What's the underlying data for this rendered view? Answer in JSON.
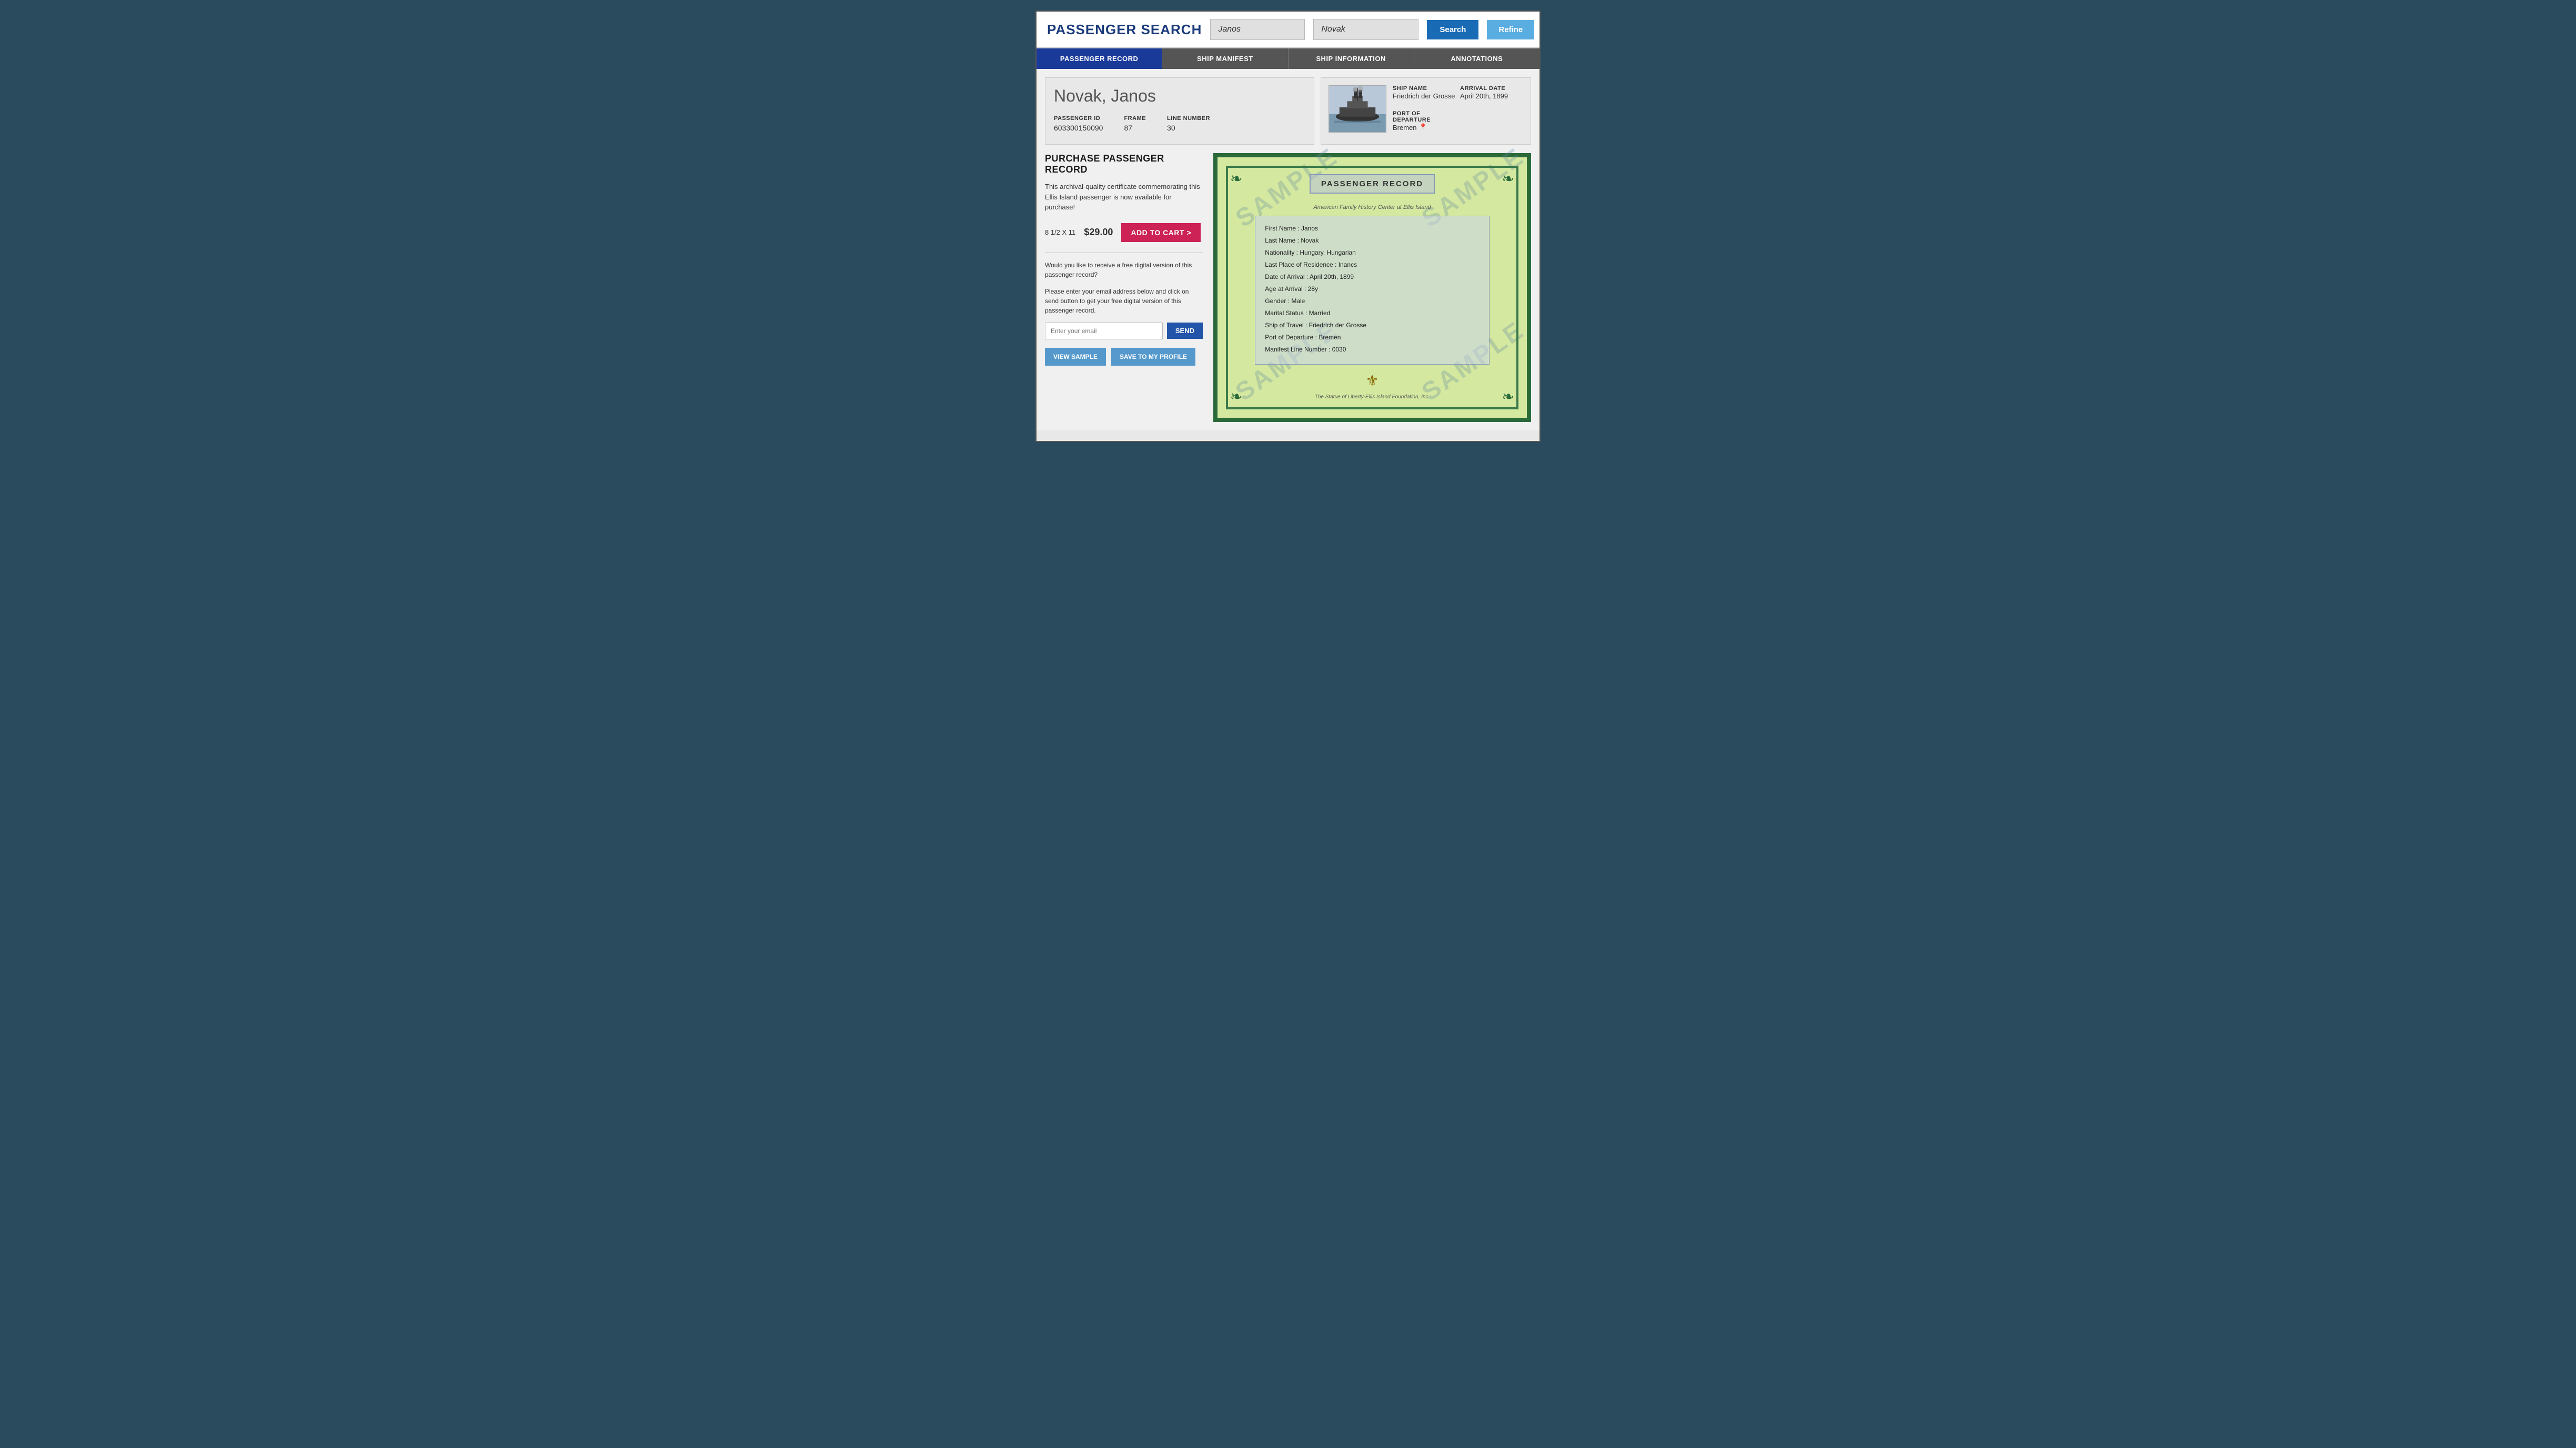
{
  "header": {
    "title": "PASSENGER SEARCH",
    "first_name_value": "Janos",
    "last_name_value": "Novak",
    "first_name_placeholder": "Janos",
    "last_name_placeholder": "Novak",
    "search_label": "Search",
    "refine_label": "Refine"
  },
  "tabs": [
    {
      "id": "passenger-record",
      "label": "PASSENGER RECORD",
      "active": true
    },
    {
      "id": "ship-manifest",
      "label": "SHIP MANIFEST",
      "active": false
    },
    {
      "id": "ship-information",
      "label": "SHIP INFORMATION",
      "active": false
    },
    {
      "id": "annotations",
      "label": "ANNOTATIONS",
      "active": false
    }
  ],
  "passenger": {
    "name": "Novak, Janos",
    "id_label": "PASSENGER ID",
    "id_value": "603300150090",
    "frame_label": "FRAME",
    "frame_value": "87",
    "line_label": "LINE NUMBER",
    "line_value": "30"
  },
  "ship": {
    "name_label": "SHIP NAME",
    "name_value": "Friedrich der Grosse",
    "arrival_label": "ARRIVAL DATE",
    "arrival_value": "April 20th, 1899",
    "departure_label": "PORT OF DEPARTURE",
    "departure_value": "Bremen"
  },
  "purchase": {
    "title": "PURCHASE PASSENGER RECORD",
    "description": "This archival-quality certificate commemorating this Ellis Island passenger is now available for purchase!",
    "size": "8 1/2 X 11",
    "price": "$29.00",
    "add_to_cart": "ADD TO CART >",
    "digital_title": "Would you like to receive a free digital version of this passenger record?",
    "digital_description": "Please enter your email address below and click on send button to get your free digital version of this passenger record.",
    "email_placeholder": "Enter your email",
    "send_label": "SEND",
    "view_sample_label": "VIEW SAMPLE",
    "save_profile_label": "SAVE TO MY PROFILE"
  },
  "certificate": {
    "watermarks": [
      "SAMPLE",
      "SAMPLE",
      "SAMPLE",
      "SAMPLE"
    ],
    "title": "PASSENGER RECORD",
    "subtitle": "American Family History Center at Ellis Island",
    "fields": [
      {
        "label": "First Name :",
        "value": "Janos"
      },
      {
        "label": "Last Name :",
        "value": "Novak"
      },
      {
        "label": "Nationality :",
        "value": "Hungary, Hungarian"
      },
      {
        "label": "Last Place of Residence :",
        "value": "Inancs"
      },
      {
        "label": "Date of Arrival :",
        "value": "April 20th, 1899"
      },
      {
        "label": "Age at Arrival :",
        "value": "28y"
      },
      {
        "label": "Gender :",
        "value": "Male"
      },
      {
        "label": "Marital Status :",
        "value": "Married"
      },
      {
        "label": "Ship of Travel :",
        "value": "Friedrich der Grosse"
      },
      {
        "label": "Port of Departure :",
        "value": "Bremen"
      },
      {
        "label": "Manifest Line Number :",
        "value": "0030"
      }
    ],
    "seal": "⚜",
    "foundation_text": "The Statue of Liberty-Ellis Island Foundation, Inc."
  }
}
